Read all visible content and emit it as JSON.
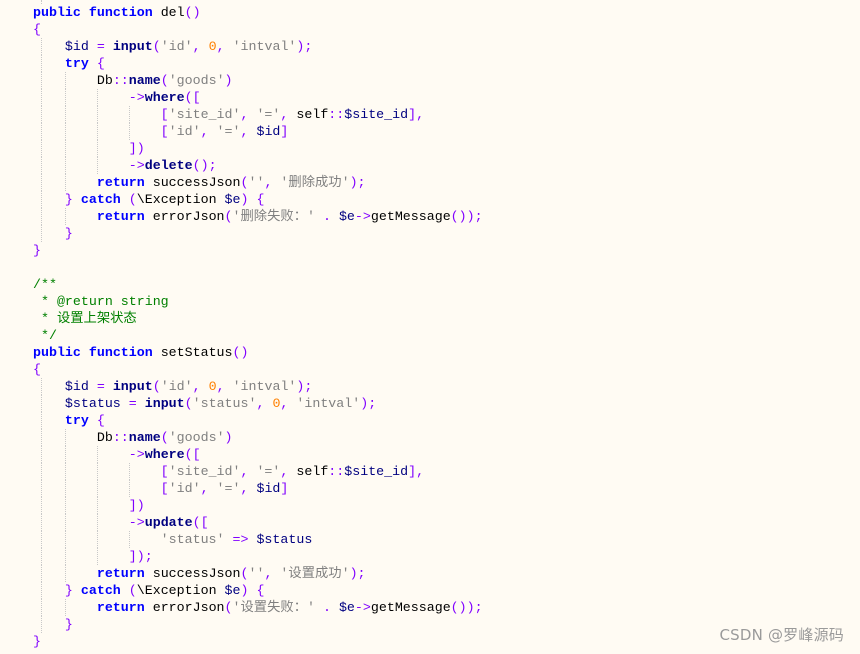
{
  "editor": {
    "theme_colors": {
      "background": "#fffbf3",
      "keyword": "#0000ff",
      "operator": "#8000ff",
      "string": "#808080",
      "number": "#ff8000",
      "variable": "#000080",
      "comment": "#008000"
    },
    "lines": [
      {
        "indent": 0,
        "tokens": [
          {
            "t": "kw",
            "v": "public"
          },
          {
            "t": "t",
            "v": " "
          },
          {
            "t": "kw",
            "v": "function"
          },
          {
            "t": "t",
            "v": " "
          },
          {
            "t": "fn",
            "v": "del"
          },
          {
            "t": "p",
            "v": "()"
          }
        ]
      },
      {
        "indent": 0,
        "tokens": [
          {
            "t": "p",
            "v": "{"
          }
        ]
      },
      {
        "indent": 1,
        "tokens": [
          {
            "t": "v",
            "v": "$id"
          },
          {
            "t": "t",
            "v": " "
          },
          {
            "t": "p",
            "v": "="
          },
          {
            "t": "t",
            "v": " "
          },
          {
            "t": "call",
            "v": "input"
          },
          {
            "t": "p",
            "v": "("
          },
          {
            "t": "s",
            "v": "'id'"
          },
          {
            "t": "p",
            "v": ","
          },
          {
            "t": "t",
            "v": " "
          },
          {
            "t": "n",
            "v": "0"
          },
          {
            "t": "p",
            "v": ","
          },
          {
            "t": "t",
            "v": " "
          },
          {
            "t": "s",
            "v": "'intval'"
          },
          {
            "t": "p",
            "v": ");"
          }
        ]
      },
      {
        "indent": 1,
        "tokens": [
          {
            "t": "kw",
            "v": "try"
          },
          {
            "t": "t",
            "v": " "
          },
          {
            "t": "p",
            "v": "{"
          }
        ]
      },
      {
        "indent": 2,
        "tokens": [
          {
            "t": "cls",
            "v": "Db"
          },
          {
            "t": "p",
            "v": "::"
          },
          {
            "t": "call",
            "v": "name"
          },
          {
            "t": "p",
            "v": "("
          },
          {
            "t": "s",
            "v": "'goods'"
          },
          {
            "t": "p",
            "v": ")"
          }
        ]
      },
      {
        "indent": 3,
        "tokens": [
          {
            "t": "p",
            "v": "->"
          },
          {
            "t": "call",
            "v": "where"
          },
          {
            "t": "p",
            "v": "(["
          }
        ]
      },
      {
        "indent": 4,
        "tokens": [
          {
            "t": "p",
            "v": "["
          },
          {
            "t": "s",
            "v": "'site_id'"
          },
          {
            "t": "p",
            "v": ","
          },
          {
            "t": "t",
            "v": " "
          },
          {
            "t": "s",
            "v": "'='"
          },
          {
            "t": "p",
            "v": ","
          },
          {
            "t": "t",
            "v": " "
          },
          {
            "t": "cls",
            "v": "self"
          },
          {
            "t": "p",
            "v": "::"
          },
          {
            "t": "v",
            "v": "$site_id"
          },
          {
            "t": "p",
            "v": "],"
          }
        ]
      },
      {
        "indent": 4,
        "tokens": [
          {
            "t": "p",
            "v": "["
          },
          {
            "t": "s",
            "v": "'id'"
          },
          {
            "t": "p",
            "v": ","
          },
          {
            "t": "t",
            "v": " "
          },
          {
            "t": "s",
            "v": "'='"
          },
          {
            "t": "p",
            "v": ","
          },
          {
            "t": "t",
            "v": " "
          },
          {
            "t": "v",
            "v": "$id"
          },
          {
            "t": "p",
            "v": "]"
          }
        ]
      },
      {
        "indent": 3,
        "tokens": [
          {
            "t": "p",
            "v": "])"
          }
        ]
      },
      {
        "indent": 3,
        "tokens": [
          {
            "t": "p",
            "v": "->"
          },
          {
            "t": "call",
            "v": "delete"
          },
          {
            "t": "p",
            "v": "();"
          }
        ]
      },
      {
        "indent": 2,
        "tokens": [
          {
            "t": "kw",
            "v": "return"
          },
          {
            "t": "t",
            "v": " "
          },
          {
            "t": "fn",
            "v": "successJson"
          },
          {
            "t": "p",
            "v": "("
          },
          {
            "t": "s",
            "v": "''"
          },
          {
            "t": "p",
            "v": ","
          },
          {
            "t": "t",
            "v": " "
          },
          {
            "t": "s",
            "v": "'删除成功'"
          },
          {
            "t": "p",
            "v": ");"
          }
        ]
      },
      {
        "indent": 1,
        "tokens": [
          {
            "t": "p",
            "v": "}"
          },
          {
            "t": "t",
            "v": " "
          },
          {
            "t": "kw",
            "v": "catch"
          },
          {
            "t": "t",
            "v": " "
          },
          {
            "t": "p",
            "v": "("
          },
          {
            "t": "cls",
            "v": "\\Exception"
          },
          {
            "t": "t",
            "v": " "
          },
          {
            "t": "v",
            "v": "$e"
          },
          {
            "t": "p",
            "v": ")"
          },
          {
            "t": "t",
            "v": " "
          },
          {
            "t": "p",
            "v": "{"
          }
        ]
      },
      {
        "indent": 2,
        "tokens": [
          {
            "t": "kw",
            "v": "return"
          },
          {
            "t": "t",
            "v": " "
          },
          {
            "t": "fn",
            "v": "errorJson"
          },
          {
            "t": "p",
            "v": "("
          },
          {
            "t": "s",
            "v": "'删除失败：'"
          },
          {
            "t": "t",
            "v": " "
          },
          {
            "t": "p",
            "v": "."
          },
          {
            "t": "t",
            "v": " "
          },
          {
            "t": "v",
            "v": "$e"
          },
          {
            "t": "p",
            "v": "->"
          },
          {
            "t": "fn",
            "v": "getMessage"
          },
          {
            "t": "p",
            "v": "());"
          }
        ]
      },
      {
        "indent": 1,
        "tokens": [
          {
            "t": "p",
            "v": "}"
          }
        ]
      },
      {
        "indent": 0,
        "tokens": [
          {
            "t": "p",
            "v": "}"
          }
        ]
      },
      {
        "indent": 0,
        "tokens": []
      },
      {
        "indent": 0,
        "tokens": [
          {
            "t": "c",
            "v": "/**"
          }
        ]
      },
      {
        "indent": 0,
        "tokens": [
          {
            "t": "c",
            "v": " * @return string"
          }
        ]
      },
      {
        "indent": 0,
        "tokens": [
          {
            "t": "c",
            "v": " * 设置上架状态"
          }
        ]
      },
      {
        "indent": 0,
        "tokens": [
          {
            "t": "c",
            "v": " */"
          }
        ]
      },
      {
        "indent": 0,
        "tokens": [
          {
            "t": "kw",
            "v": "public"
          },
          {
            "t": "t",
            "v": " "
          },
          {
            "t": "kw",
            "v": "function"
          },
          {
            "t": "t",
            "v": " "
          },
          {
            "t": "fn",
            "v": "setStatus"
          },
          {
            "t": "p",
            "v": "()"
          }
        ]
      },
      {
        "indent": 0,
        "tokens": [
          {
            "t": "p",
            "v": "{"
          }
        ]
      },
      {
        "indent": 1,
        "tokens": [
          {
            "t": "v",
            "v": "$id"
          },
          {
            "t": "t",
            "v": " "
          },
          {
            "t": "p",
            "v": "="
          },
          {
            "t": "t",
            "v": " "
          },
          {
            "t": "call",
            "v": "input"
          },
          {
            "t": "p",
            "v": "("
          },
          {
            "t": "s",
            "v": "'id'"
          },
          {
            "t": "p",
            "v": ","
          },
          {
            "t": "t",
            "v": " "
          },
          {
            "t": "n",
            "v": "0"
          },
          {
            "t": "p",
            "v": ","
          },
          {
            "t": "t",
            "v": " "
          },
          {
            "t": "s",
            "v": "'intval'"
          },
          {
            "t": "p",
            "v": ");"
          }
        ]
      },
      {
        "indent": 1,
        "tokens": [
          {
            "t": "v",
            "v": "$status"
          },
          {
            "t": "t",
            "v": " "
          },
          {
            "t": "p",
            "v": "="
          },
          {
            "t": "t",
            "v": " "
          },
          {
            "t": "call",
            "v": "input"
          },
          {
            "t": "p",
            "v": "("
          },
          {
            "t": "s",
            "v": "'status'"
          },
          {
            "t": "p",
            "v": ","
          },
          {
            "t": "t",
            "v": " "
          },
          {
            "t": "n",
            "v": "0"
          },
          {
            "t": "p",
            "v": ","
          },
          {
            "t": "t",
            "v": " "
          },
          {
            "t": "s",
            "v": "'intval'"
          },
          {
            "t": "p",
            "v": ");"
          }
        ]
      },
      {
        "indent": 1,
        "tokens": [
          {
            "t": "kw",
            "v": "try"
          },
          {
            "t": "t",
            "v": " "
          },
          {
            "t": "p",
            "v": "{"
          }
        ]
      },
      {
        "indent": 2,
        "tokens": [
          {
            "t": "cls",
            "v": "Db"
          },
          {
            "t": "p",
            "v": "::"
          },
          {
            "t": "call",
            "v": "name"
          },
          {
            "t": "p",
            "v": "("
          },
          {
            "t": "s",
            "v": "'goods'"
          },
          {
            "t": "p",
            "v": ")"
          }
        ]
      },
      {
        "indent": 3,
        "tokens": [
          {
            "t": "p",
            "v": "->"
          },
          {
            "t": "call",
            "v": "where"
          },
          {
            "t": "p",
            "v": "(["
          }
        ]
      },
      {
        "indent": 4,
        "tokens": [
          {
            "t": "p",
            "v": "["
          },
          {
            "t": "s",
            "v": "'site_id'"
          },
          {
            "t": "p",
            "v": ","
          },
          {
            "t": "t",
            "v": " "
          },
          {
            "t": "s",
            "v": "'='"
          },
          {
            "t": "p",
            "v": ","
          },
          {
            "t": "t",
            "v": " "
          },
          {
            "t": "cls",
            "v": "self"
          },
          {
            "t": "p",
            "v": "::"
          },
          {
            "t": "v",
            "v": "$site_id"
          },
          {
            "t": "p",
            "v": "],"
          }
        ]
      },
      {
        "indent": 4,
        "tokens": [
          {
            "t": "p",
            "v": "["
          },
          {
            "t": "s",
            "v": "'id'"
          },
          {
            "t": "p",
            "v": ","
          },
          {
            "t": "t",
            "v": " "
          },
          {
            "t": "s",
            "v": "'='"
          },
          {
            "t": "p",
            "v": ","
          },
          {
            "t": "t",
            "v": " "
          },
          {
            "t": "v",
            "v": "$id"
          },
          {
            "t": "p",
            "v": "]"
          }
        ]
      },
      {
        "indent": 3,
        "tokens": [
          {
            "t": "p",
            "v": "])"
          }
        ]
      },
      {
        "indent": 3,
        "tokens": [
          {
            "t": "p",
            "v": "->"
          },
          {
            "t": "call",
            "v": "update"
          },
          {
            "t": "p",
            "v": "(["
          }
        ]
      },
      {
        "indent": 4,
        "tokens": [
          {
            "t": "s",
            "v": "'status'"
          },
          {
            "t": "t",
            "v": " "
          },
          {
            "t": "p",
            "v": "=>"
          },
          {
            "t": "t",
            "v": " "
          },
          {
            "t": "v",
            "v": "$status"
          }
        ]
      },
      {
        "indent": 3,
        "tokens": [
          {
            "t": "p",
            "v": "]);"
          }
        ]
      },
      {
        "indent": 2,
        "tokens": [
          {
            "t": "kw",
            "v": "return"
          },
          {
            "t": "t",
            "v": " "
          },
          {
            "t": "fn",
            "v": "successJson"
          },
          {
            "t": "p",
            "v": "("
          },
          {
            "t": "s",
            "v": "''"
          },
          {
            "t": "p",
            "v": ","
          },
          {
            "t": "t",
            "v": " "
          },
          {
            "t": "s",
            "v": "'设置成功'"
          },
          {
            "t": "p",
            "v": ");"
          }
        ]
      },
      {
        "indent": 1,
        "tokens": [
          {
            "t": "p",
            "v": "}"
          },
          {
            "t": "t",
            "v": " "
          },
          {
            "t": "kw",
            "v": "catch"
          },
          {
            "t": "t",
            "v": " "
          },
          {
            "t": "p",
            "v": "("
          },
          {
            "t": "cls",
            "v": "\\Exception"
          },
          {
            "t": "t",
            "v": " "
          },
          {
            "t": "v",
            "v": "$e"
          },
          {
            "t": "p",
            "v": ")"
          },
          {
            "t": "t",
            "v": " "
          },
          {
            "t": "p",
            "v": "{"
          }
        ]
      },
      {
        "indent": 2,
        "tokens": [
          {
            "t": "kw",
            "v": "return"
          },
          {
            "t": "t",
            "v": " "
          },
          {
            "t": "fn",
            "v": "errorJson"
          },
          {
            "t": "p",
            "v": "("
          },
          {
            "t": "s",
            "v": "'设置失败：'"
          },
          {
            "t": "t",
            "v": " "
          },
          {
            "t": "p",
            "v": "."
          },
          {
            "t": "t",
            "v": " "
          },
          {
            "t": "v",
            "v": "$e"
          },
          {
            "t": "p",
            "v": "->"
          },
          {
            "t": "fn",
            "v": "getMessage"
          },
          {
            "t": "p",
            "v": "());"
          }
        ]
      },
      {
        "indent": 1,
        "tokens": [
          {
            "t": "p",
            "v": "}"
          }
        ]
      },
      {
        "indent": 0,
        "tokens": [
          {
            "t": "p",
            "v": "}"
          }
        ]
      }
    ]
  },
  "watermark": {
    "text": "CSDN @罗峰源码"
  }
}
